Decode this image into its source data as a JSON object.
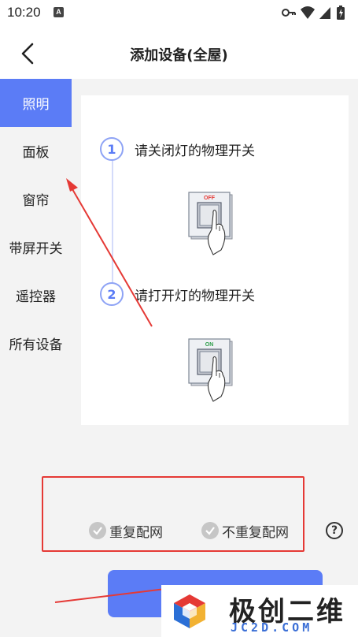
{
  "status_bar": {
    "time": "10:20",
    "notification_letter": "A"
  },
  "header": {
    "title": "添加设备(全屋)"
  },
  "sidebar": {
    "items": [
      {
        "label": "照明",
        "active": true
      },
      {
        "label": "面板",
        "active": false
      },
      {
        "label": "窗帘",
        "active": false
      },
      {
        "label": "带屏开关",
        "active": false
      },
      {
        "label": "遥控器",
        "active": false
      },
      {
        "label": "所有设备",
        "active": false
      }
    ]
  },
  "card": {
    "steps": [
      {
        "num": "1",
        "text": "请关闭灯的物理开关",
        "switch_label": "OFF"
      },
      {
        "num": "2",
        "text": "请打开灯的物理开关",
        "switch_label": "ON"
      }
    ]
  },
  "options": {
    "reconfigure": "重复配网",
    "no_reconfigure": "不重复配网",
    "help": "?"
  },
  "watermark": {
    "cn": "极创二维",
    "en": "JC2D.COM"
  },
  "colors": {
    "accent": "#5b7cf6",
    "annotation": "#e53935"
  }
}
